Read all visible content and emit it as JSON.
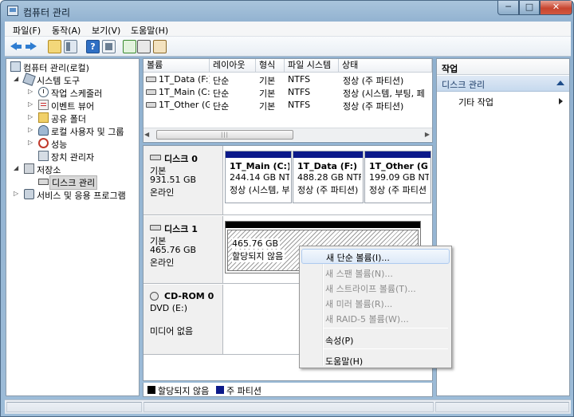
{
  "window": {
    "title": "컴퓨터 관리",
    "min": "─",
    "max": "□",
    "close": "✕"
  },
  "menu": [
    "파일(F)",
    "동작(A)",
    "보기(V)",
    "도움말(H)"
  ],
  "toolbar": {
    "help": "?"
  },
  "tree": {
    "root": "컴퓨터 관리(로컬)",
    "system_tools": "시스템 도구",
    "task_scheduler": "작업 스케줄러",
    "event_viewer": "이벤트 뷰어",
    "shared_folders": "공유 폴더",
    "local_users": "로컬 사용자 및 그룹",
    "performance": "성능",
    "device_manager": "장치 관리자",
    "storage": "저장소",
    "disk_management": "디스크 관리",
    "services": "서비스 및 응용 프로그램",
    "expand_closed": "▷",
    "expand_open": "◢"
  },
  "volume_list": {
    "columns": [
      "볼륨",
      "레이아웃",
      "형식",
      "파일 시스템",
      "상태"
    ],
    "rows": [
      [
        "1T_Data (F:)",
        "단순",
        "기본",
        "NTFS",
        "정상 (주 파티션)"
      ],
      [
        "1T_Main (C:)",
        "단순",
        "기본",
        "NTFS",
        "정상 (시스템, 부팅, 페"
      ],
      [
        "1T_Other (G:)",
        "단순",
        "기본",
        "NTFS",
        "정상 (주 파티션)"
      ]
    ],
    "scroll_left": "◀",
    "scroll_right": "▶",
    "scroll_grip": "|||"
  },
  "disks": {
    "disk0": {
      "name": "디스크 0",
      "type": "기본",
      "size": "931.51 GB",
      "status": "온라인",
      "partitions": [
        {
          "name": "1T_Main  (C:)",
          "size": "244.14 GB NTF",
          "status": "정상 (시스템, 부"
        },
        {
          "name": "1T_Data  (F:)",
          "size": "488.28 GB NTF",
          "status": "정상 (주 파티션)"
        },
        {
          "name": "1T_Other  (G:)",
          "size": "199.09 GB NTF",
          "status": "정상 (주 파티션"
        }
      ]
    },
    "disk1": {
      "name": "디스크 1",
      "type": "기본",
      "size": "465.76 GB",
      "status": "온라인",
      "unallocated": {
        "size": "465.76 GB",
        "status": "할당되지 않음"
      }
    },
    "cdrom": {
      "name": "CD-ROM 0",
      "type": "DVD (E:)",
      "status": "미디어 없음"
    }
  },
  "legend": {
    "unallocated": "할당되지 않음",
    "primary": "주 파티션"
  },
  "actions": {
    "header": "작업",
    "selected": "디스크 관리",
    "more": "기타 작업"
  },
  "context_menu": {
    "new_simple": "새 단순 볼륨(I)...",
    "new_spanned": "새 스팬 볼륨(N)...",
    "new_striped": "새 스트라이프 볼륨(T)...",
    "new_mirrored": "새 미러 볼륨(R)...",
    "new_raid5": "새 RAID-5 볼륨(W)...",
    "properties": "속성(P)",
    "help": "도움말(H)"
  },
  "colors": {
    "primary_partition": "#0c1a8a",
    "unallocated": "#000000",
    "accent": "#c6d9ee"
  }
}
